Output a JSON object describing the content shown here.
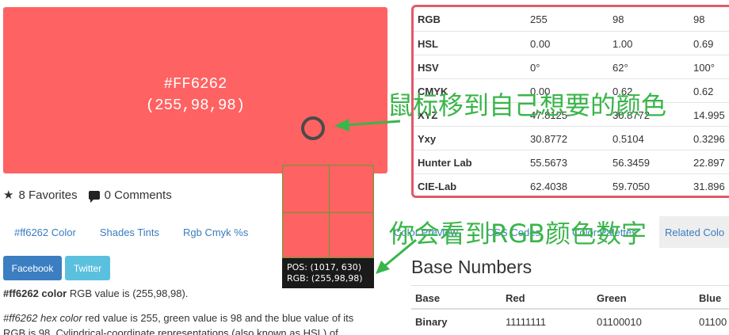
{
  "swatch": {
    "hex": "#FF6262",
    "rgb": "(255,98,98)",
    "color": "#ff6262"
  },
  "favorites": {
    "count": "8",
    "label": "Favorites"
  },
  "comments": {
    "count": "0",
    "label": "Comments"
  },
  "left_tabs": [
    "#ff6262 Color",
    "Shades Tints",
    "Rgb Cmyk %s"
  ],
  "share": {
    "facebook": "Facebook",
    "twitter": "Twitter"
  },
  "description": {
    "p1_bold": "#ff6262 color",
    "p1_rest": " RGB value is (255,98,98).",
    "p2_em": "#ff6262 hex color",
    "p2_rest": " red value is 255, green value is 98 and the blue value of its",
    "p3": "RGB is 98. Cylindrical-coordinate representations (also known as HSL) of"
  },
  "magnifier": {
    "pos": "POS: (1017, 630)",
    "rgb": "RGB: (255,98,98)"
  },
  "conversion_table": [
    {
      "label": "RGB",
      "v1": "255",
      "v2": "98",
      "v3": "98"
    },
    {
      "label": "HSL",
      "v1": "0.00",
      "v2": "1.00",
      "v3": "0.69"
    },
    {
      "label": "HSV",
      "v1": "0°",
      "v2": "62°",
      "v3": "100°"
    },
    {
      "label": "CMYK",
      "v1": "0.00",
      "v2": "0.62",
      "v3": "0.62"
    },
    {
      "label": "XYZ",
      "v1": "47.8125",
      "v2": "30.8772",
      "v3": "14.995"
    },
    {
      "label": "Yxy",
      "v1": "30.8772",
      "v2": "0.5104",
      "v3": "0.3296"
    },
    {
      "label": "Hunter Lab",
      "v1": "55.5673",
      "v2": "56.3459",
      "v3": "22.897"
    },
    {
      "label": "CIE-Lab",
      "v1": "62.4038",
      "v2": "59.7050",
      "v3": "31.896"
    }
  ],
  "right_tabs": [
    "Color Preview",
    "CSS Codes",
    "Color Palettes",
    "Related Colo"
  ],
  "base_numbers": {
    "title": "Base Numbers",
    "headers": [
      "Base",
      "Red",
      "Green",
      "Blue"
    ],
    "row": [
      "Binary",
      "11111111",
      "01100010",
      "01100"
    ]
  },
  "annotations": {
    "note1": "鼠标移到自己想要的颜色",
    "note2": "你会看到RGB颜色数字",
    "color": "#3ab54a"
  }
}
